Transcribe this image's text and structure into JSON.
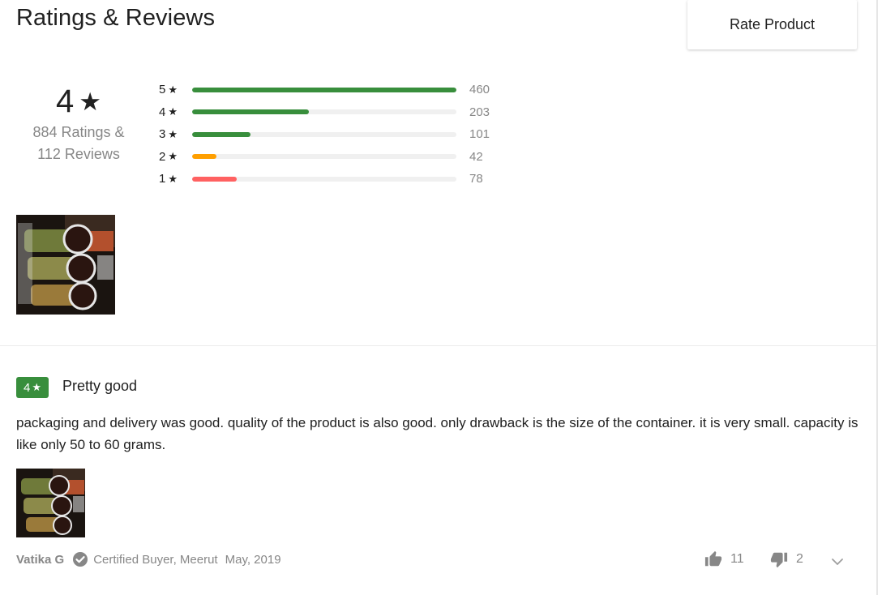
{
  "header": {
    "title": "Ratings & Reviews",
    "rate_button": "Rate Product"
  },
  "summary": {
    "average": "4",
    "star_glyph": "★",
    "ratings_line": "884 Ratings &",
    "reviews_line": "112 Reviews"
  },
  "distribution": [
    {
      "stars": "5",
      "count": "460",
      "fraction": 1.0,
      "color": "#388e3c"
    },
    {
      "stars": "4",
      "count": "203",
      "fraction": 0.441,
      "color": "#388e3c"
    },
    {
      "stars": "3",
      "count": "101",
      "fraction": 0.22,
      "color": "#388e3c"
    },
    {
      "stars": "2",
      "count": "42",
      "fraction": 0.091,
      "color": "#ff9f00"
    },
    {
      "stars": "1",
      "count": "78",
      "fraction": 0.17,
      "color": "#ff6161"
    }
  ],
  "review": {
    "rating": "4",
    "title": "Pretty good",
    "body": "packaging and delivery was good. quality of the product is also good. only drawback is the size of the container. it is very small. capacity is like only 50 to 60 grams.",
    "reviewer": "Vatika G",
    "certification": "Certified Buyer, Meerut",
    "date": "May, 2019",
    "likes": "11",
    "dislikes": "2"
  },
  "icons": {
    "check": "check-circle-icon",
    "like": "thumbs-up-icon",
    "dislike": "thumbs-down-icon",
    "expand": "chevron-down-icon"
  }
}
